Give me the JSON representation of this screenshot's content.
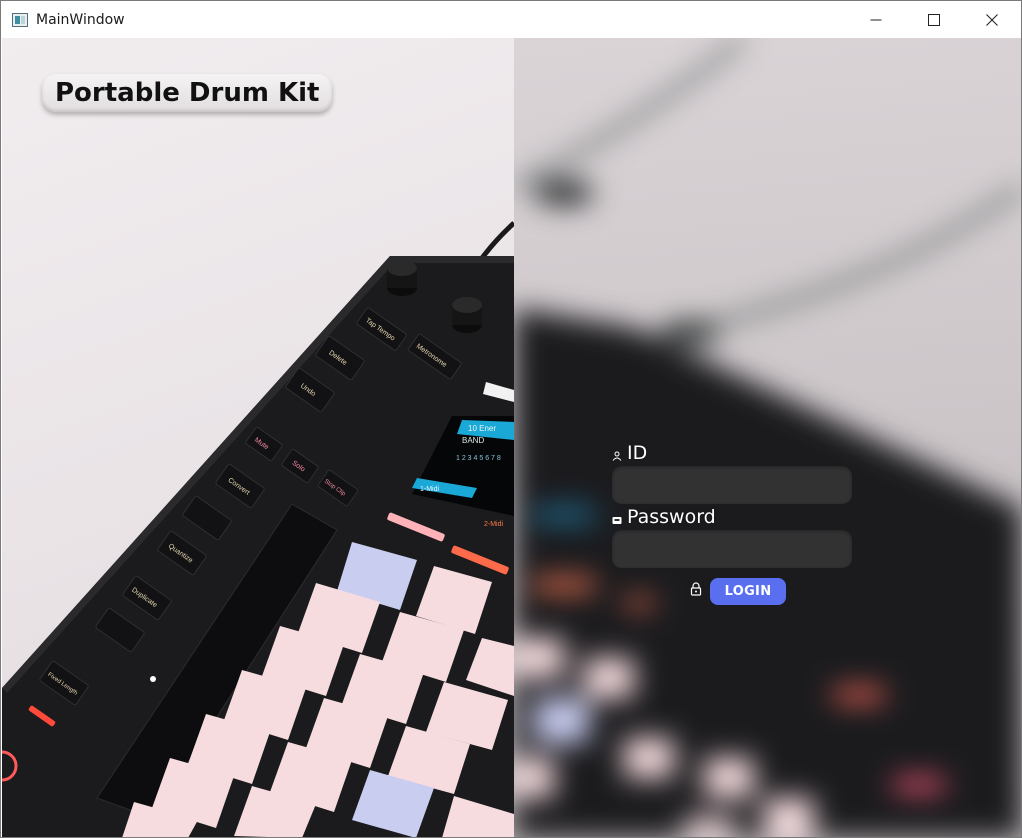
{
  "window": {
    "title": "MainWindow"
  },
  "app": {
    "title": "Portable Drum Kit"
  },
  "login": {
    "id_label": "ID",
    "id_value": "",
    "password_label": "Password",
    "password_value": "",
    "button_label": "LOGIN"
  },
  "device_labels": {
    "tap_tempo": "Tap Tempo",
    "metronome": "Metronome",
    "delete": "Delete",
    "undo": "Undo",
    "mute": "Mute",
    "solo": "Solo",
    "stop_clip": "Stop Clip",
    "convert": "Convert",
    "quantize": "Quantize",
    "duplicate": "Duplicate",
    "fixed_length": "Fixed Length",
    "screen_line1": "10 Ener",
    "screen_line2": "BAND",
    "screen_line3": "1 2 3 4 5 6 7 8",
    "screen_tab1": "1-Midi",
    "screen_tab2": "2-Midi"
  },
  "icons": {
    "window_icon": "app-window-icon",
    "minimize": "minimize-icon",
    "maximize": "maximize-icon",
    "close": "close-icon",
    "user": "user-icon",
    "password": "key-icon",
    "lock": "lock-icon"
  },
  "colors": {
    "accent": "#5a6ff0",
    "pad_pink": "#f6dcdf",
    "pad_lavender": "#c9cdf0",
    "device_body": "#1b1b1d",
    "screen_cyan": "#1aa8d6"
  }
}
